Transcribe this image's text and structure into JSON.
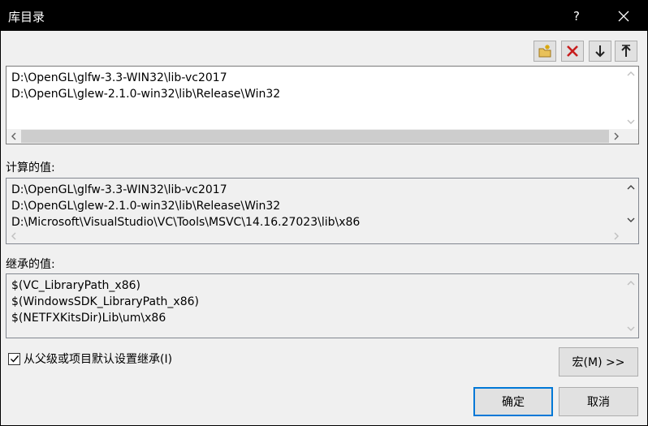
{
  "window": {
    "title": "库目录",
    "help_label": "?"
  },
  "toolbar": {
    "icons": [
      "new-line-icon",
      "delete-icon",
      "move-down-icon",
      "move-up-icon"
    ]
  },
  "editor": {
    "lines": [
      "D:\\OpenGL\\glfw-3.3-WIN32\\lib-vc2017",
      "D:\\OpenGL\\glew-2.1.0-win32\\lib\\Release\\Win32"
    ]
  },
  "evaluated": {
    "label": "计算的值:",
    "lines": [
      "D:\\OpenGL\\glfw-3.3-WIN32\\lib-vc2017",
      "D:\\OpenGL\\glew-2.1.0-win32\\lib\\Release\\Win32",
      "D:\\Microsoft\\VisualStudio\\VC\\Tools\\MSVC\\14.16.27023\\lib\\x86"
    ]
  },
  "inherited": {
    "label": "继承的值:",
    "lines": [
      "$(VC_LibraryPath_x86)",
      "$(WindowsSDK_LibraryPath_x86)",
      "$(NETFXKitsDir)Lib\\um\\x86"
    ]
  },
  "inherit_checkbox": {
    "label": "从父级或项目默认设置继承(I)",
    "checked": true
  },
  "buttons": {
    "macro": "宏(M) >>",
    "ok": "确定",
    "cancel": "取消"
  },
  "colors": {
    "titlebar": "#000000",
    "dialog_bg": "#f0f0f0",
    "default_button_border": "#0078d7"
  }
}
